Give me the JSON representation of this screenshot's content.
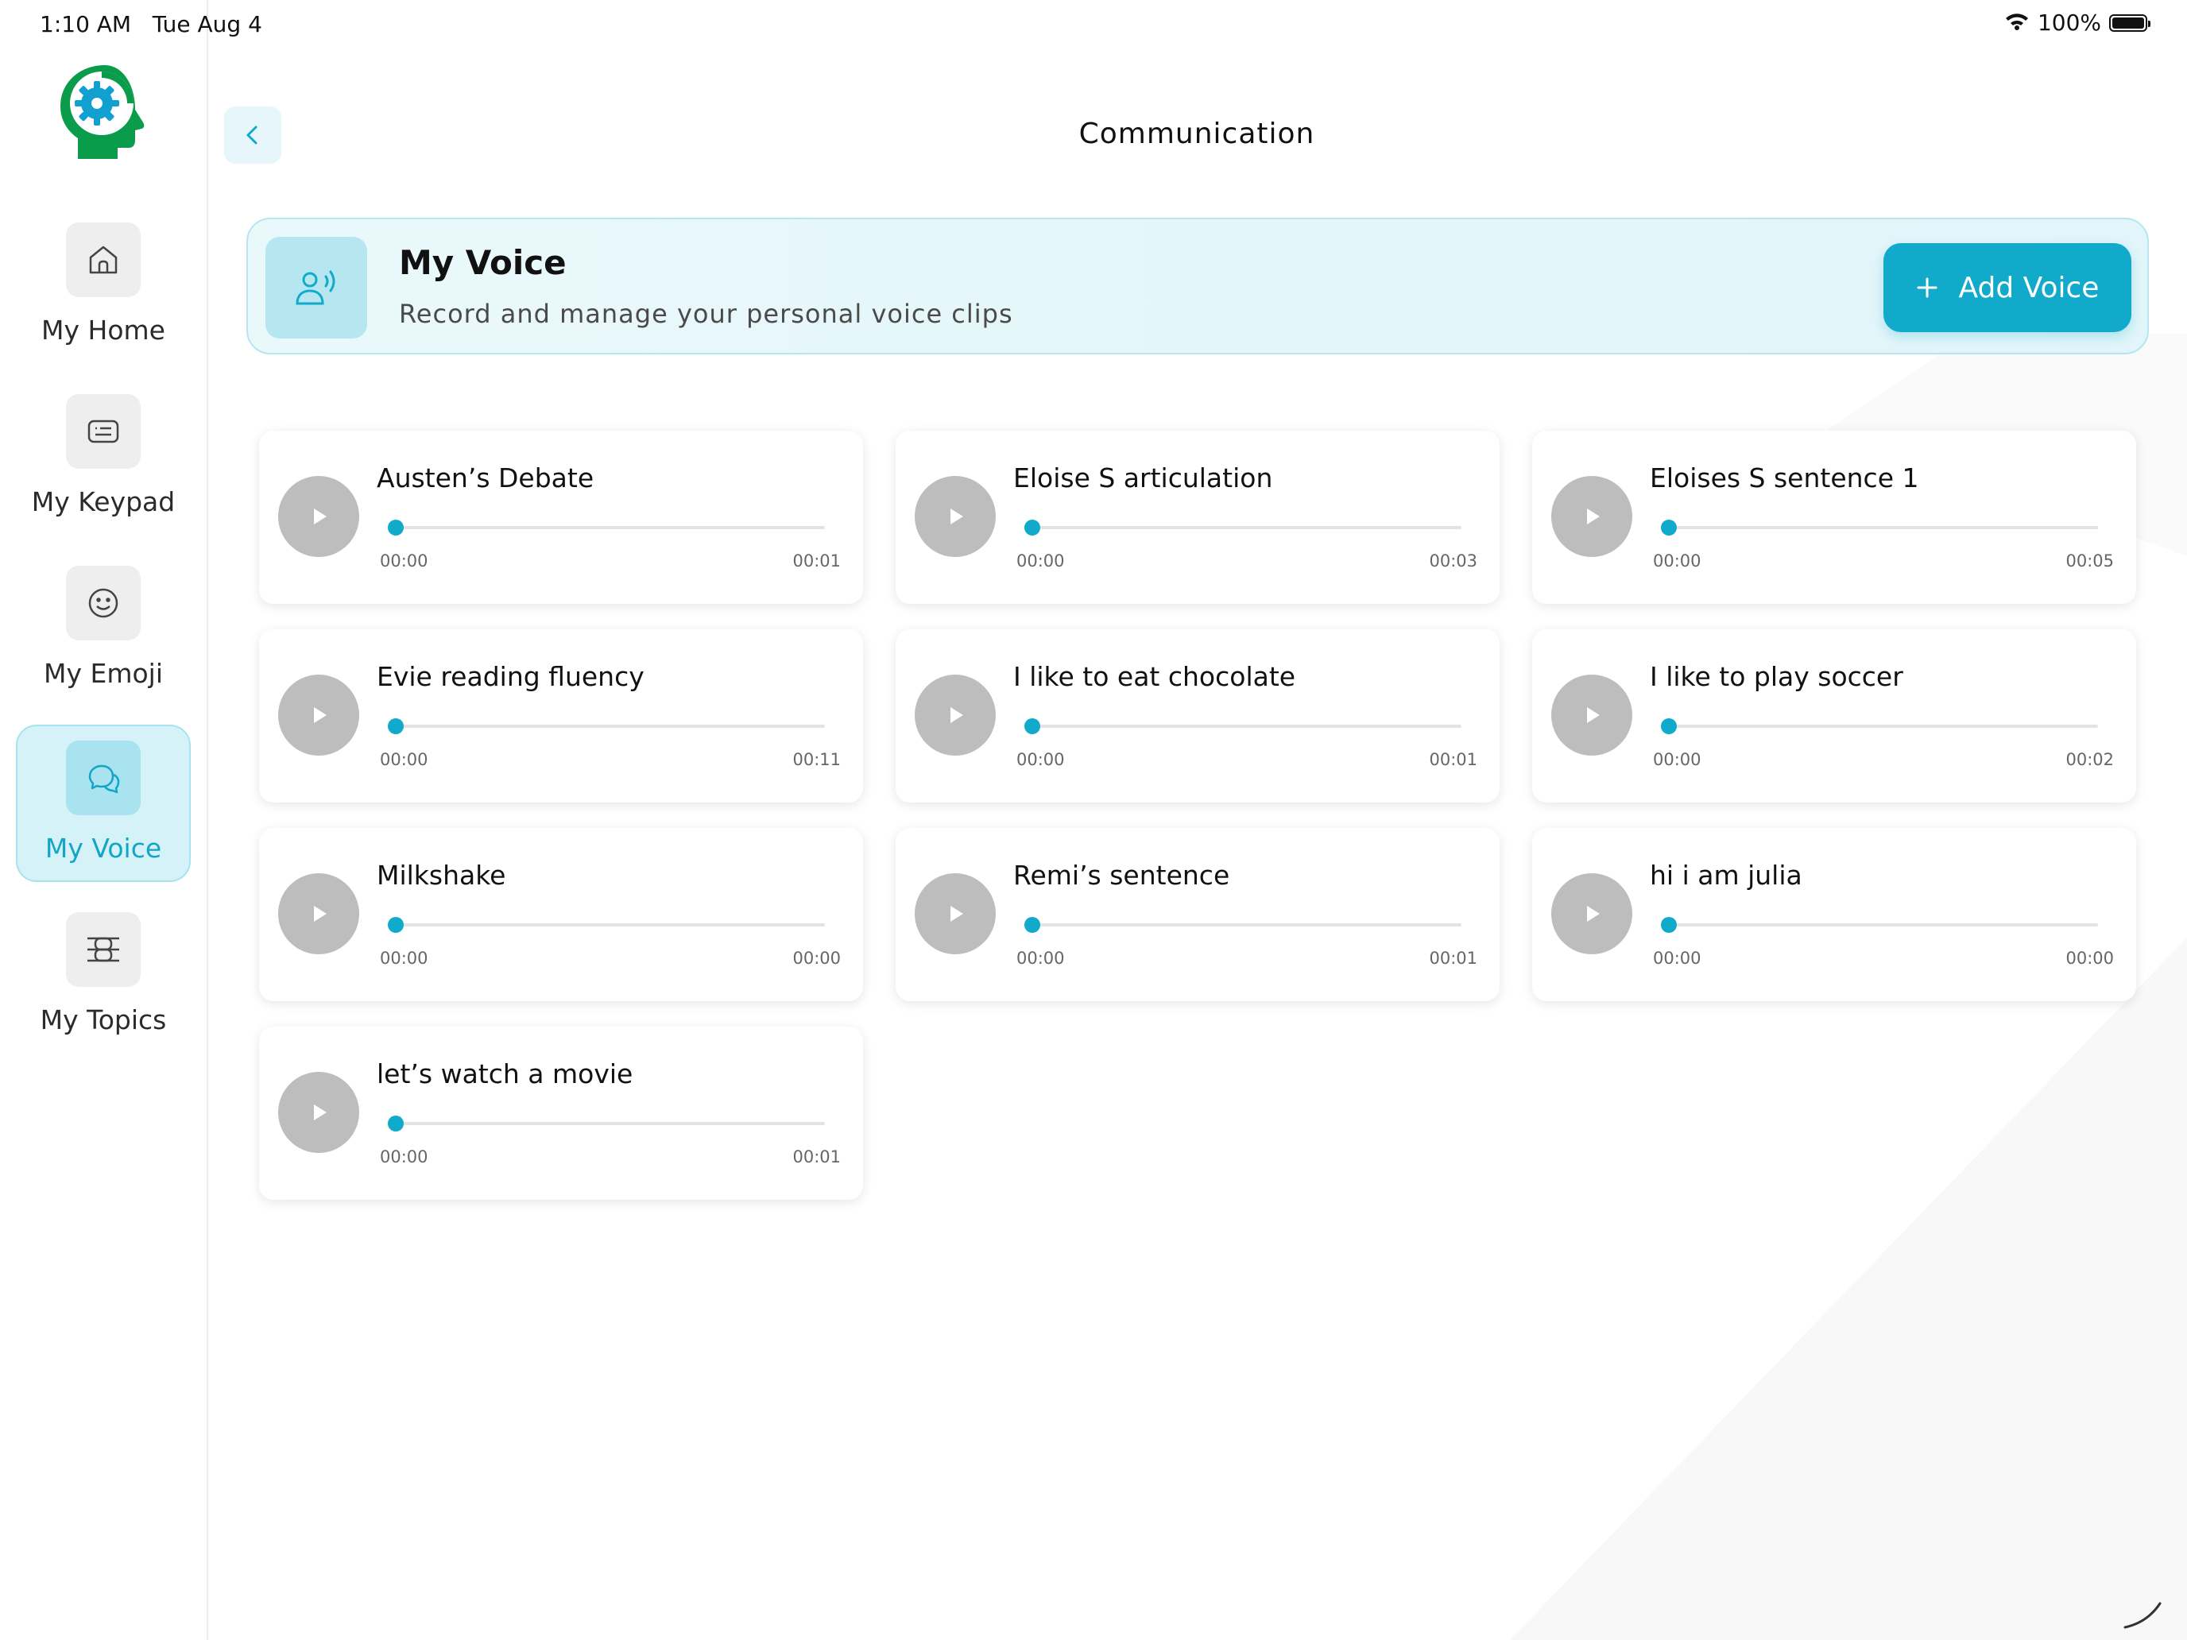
{
  "status_bar": {
    "time": "1:10 AM",
    "date": "Tue Aug 4",
    "battery": "100%",
    "wifi_icon": "wifi-icon",
    "battery_level": 1.0
  },
  "sidebar": {
    "items": [
      {
        "label": "My Home",
        "icon": "home-icon",
        "active": false
      },
      {
        "label": "My Keypad",
        "icon": "keyboard-icon",
        "active": false
      },
      {
        "label": "My Emoji",
        "icon": "smiley-icon",
        "active": false
      },
      {
        "label": "My Voice",
        "icon": "chat-bubbles-icon",
        "active": true
      },
      {
        "label": "My Topics",
        "icon": "topics-icon",
        "active": false
      }
    ]
  },
  "header": {
    "title": "Communication",
    "back_icon": "chevron-left-icon"
  },
  "banner": {
    "title": "My Voice",
    "subtitle": "Record and manage your personal voice clips",
    "icon": "voice-user-icon",
    "add_button_label": "Add Voice"
  },
  "clips": [
    {
      "title": "Austen’s Debate",
      "current": "00:00",
      "duration": "00:01",
      "progress": 0
    },
    {
      "title": "Eloise S articulation",
      "current": "00:00",
      "duration": "00:03",
      "progress": 0
    },
    {
      "title": "Eloises S sentence 1",
      "current": "00:00",
      "duration": "00:05",
      "progress": 0
    },
    {
      "title": "Evie reading fluency",
      "current": "00:00",
      "duration": "00:11",
      "progress": 0
    },
    {
      "title": "I like to eat chocolate",
      "current": "00:00",
      "duration": "00:01",
      "progress": 0
    },
    {
      "title": "I like to play soccer",
      "current": "00:00",
      "duration": "00:02",
      "progress": 0
    },
    {
      "title": "Milkshake",
      "current": "00:00",
      "duration": "00:00",
      "progress": 0
    },
    {
      "title": "Remi’s sentence",
      "current": "00:00",
      "duration": "00:01",
      "progress": 0
    },
    {
      "title": "hi i am julia",
      "current": "00:00",
      "duration": "00:00",
      "progress": 0
    },
    {
      "title": "let’s watch a movie",
      "current": "00:00",
      "duration": "00:01",
      "progress": 0
    }
  ],
  "colors": {
    "accent": "#12aacb",
    "accent_light": "#d4f2f8",
    "play_button": "#bdbdbd",
    "logo_green": "#0a9b4b"
  }
}
